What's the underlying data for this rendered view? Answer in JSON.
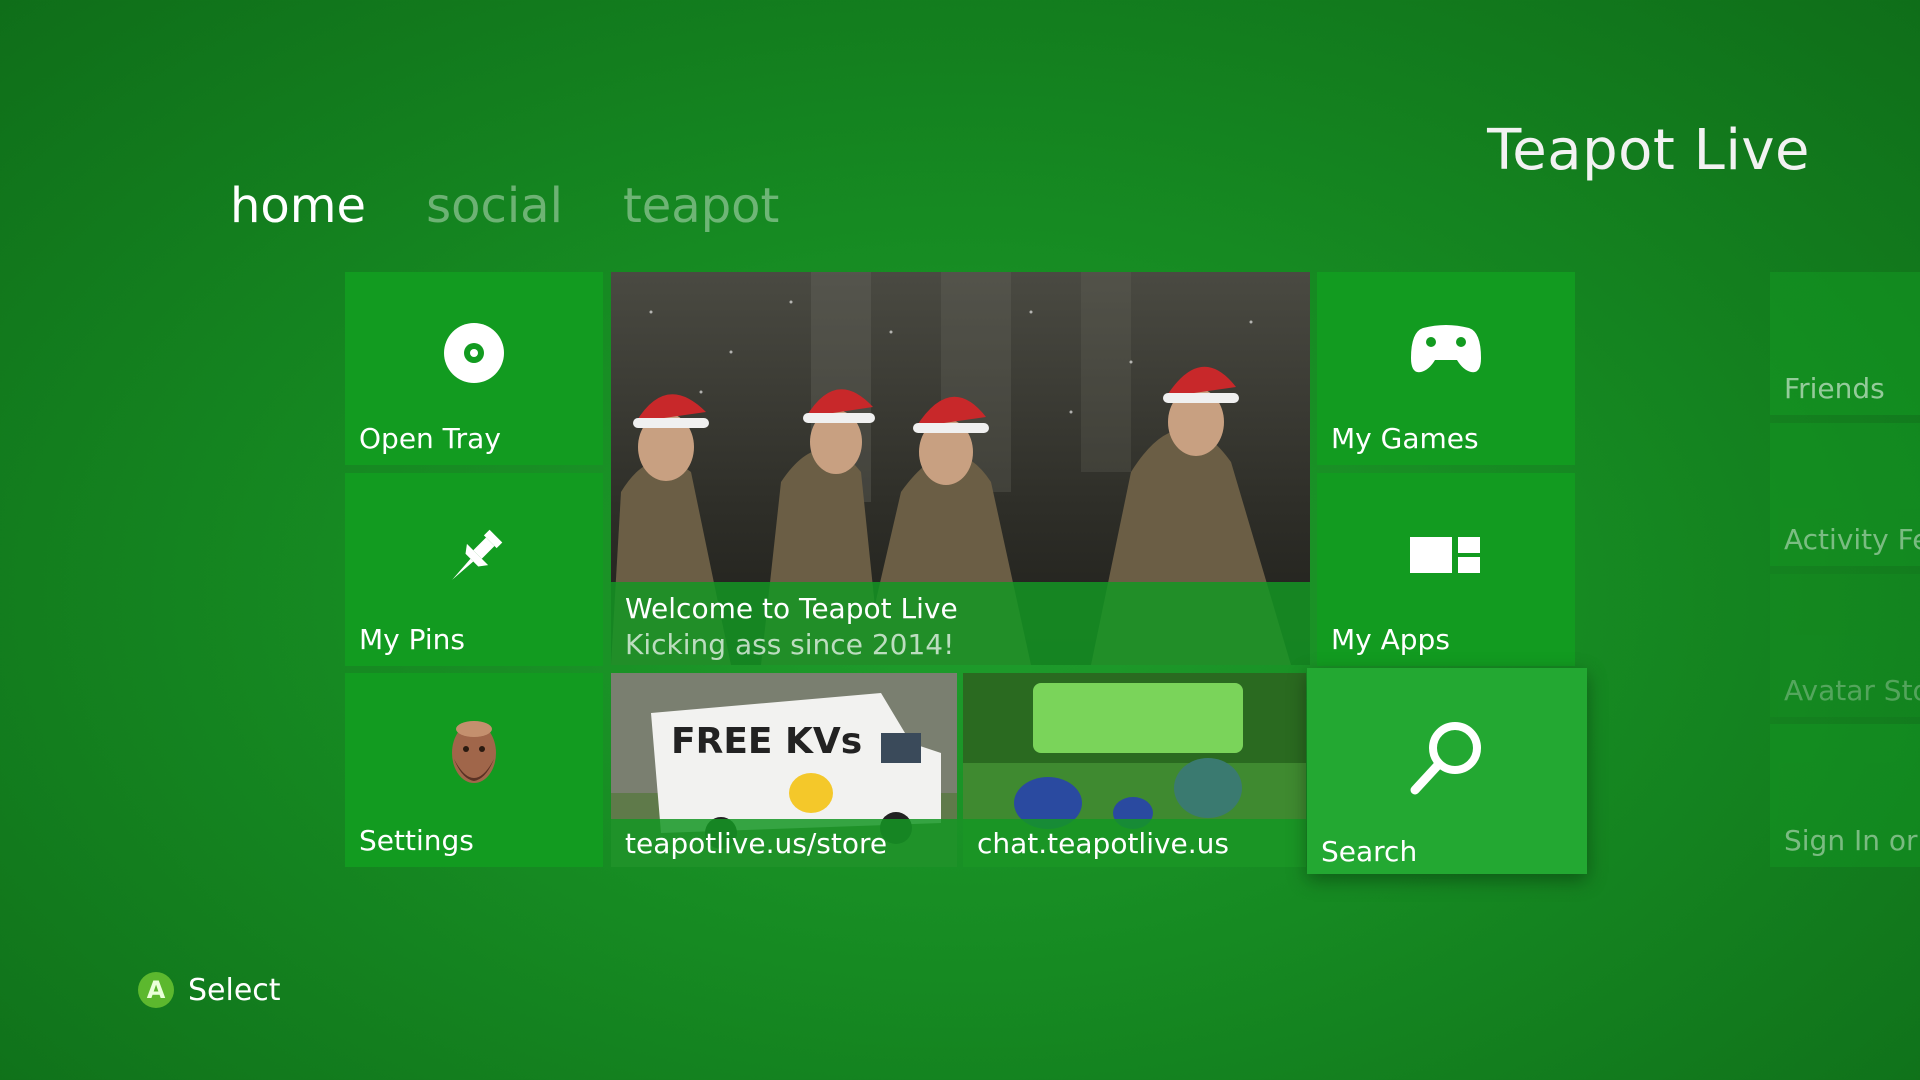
{
  "header": {
    "brand": "Teapot Live"
  },
  "tabs": [
    {
      "label": "home"
    },
    {
      "label": "social"
    },
    {
      "label": "teapot"
    }
  ],
  "tiles": {
    "open_tray": {
      "label": "Open Tray",
      "icon": "disc-icon"
    },
    "my_pins": {
      "label": "My Pins",
      "icon": "pin-icon"
    },
    "settings": {
      "label": "Settings",
      "icon": "avatar"
    },
    "featured": {
      "title": "Welcome to Teapot Live",
      "subtitle": "Kicking ass since 2014!"
    },
    "store": {
      "label": "teapotlive.us/store",
      "van_text": "FREE KVs"
    },
    "chat": {
      "label": "chat.teapotlive.us"
    },
    "my_games": {
      "label": "My Games",
      "icon": "controller-icon"
    },
    "my_apps": {
      "label": "My Apps",
      "icon": "apps-icon"
    },
    "search": {
      "label": "Search",
      "icon": "search-icon"
    }
  },
  "side_panel": [
    {
      "label": "Friends"
    },
    {
      "label": "Activity Fe"
    },
    {
      "label": "Avatar Sto"
    },
    {
      "label": "Sign In or"
    }
  ],
  "footer": {
    "button": "A",
    "hint": "Select"
  },
  "colors": {
    "tile": "#129b20",
    "accent": "#5cb82e"
  }
}
